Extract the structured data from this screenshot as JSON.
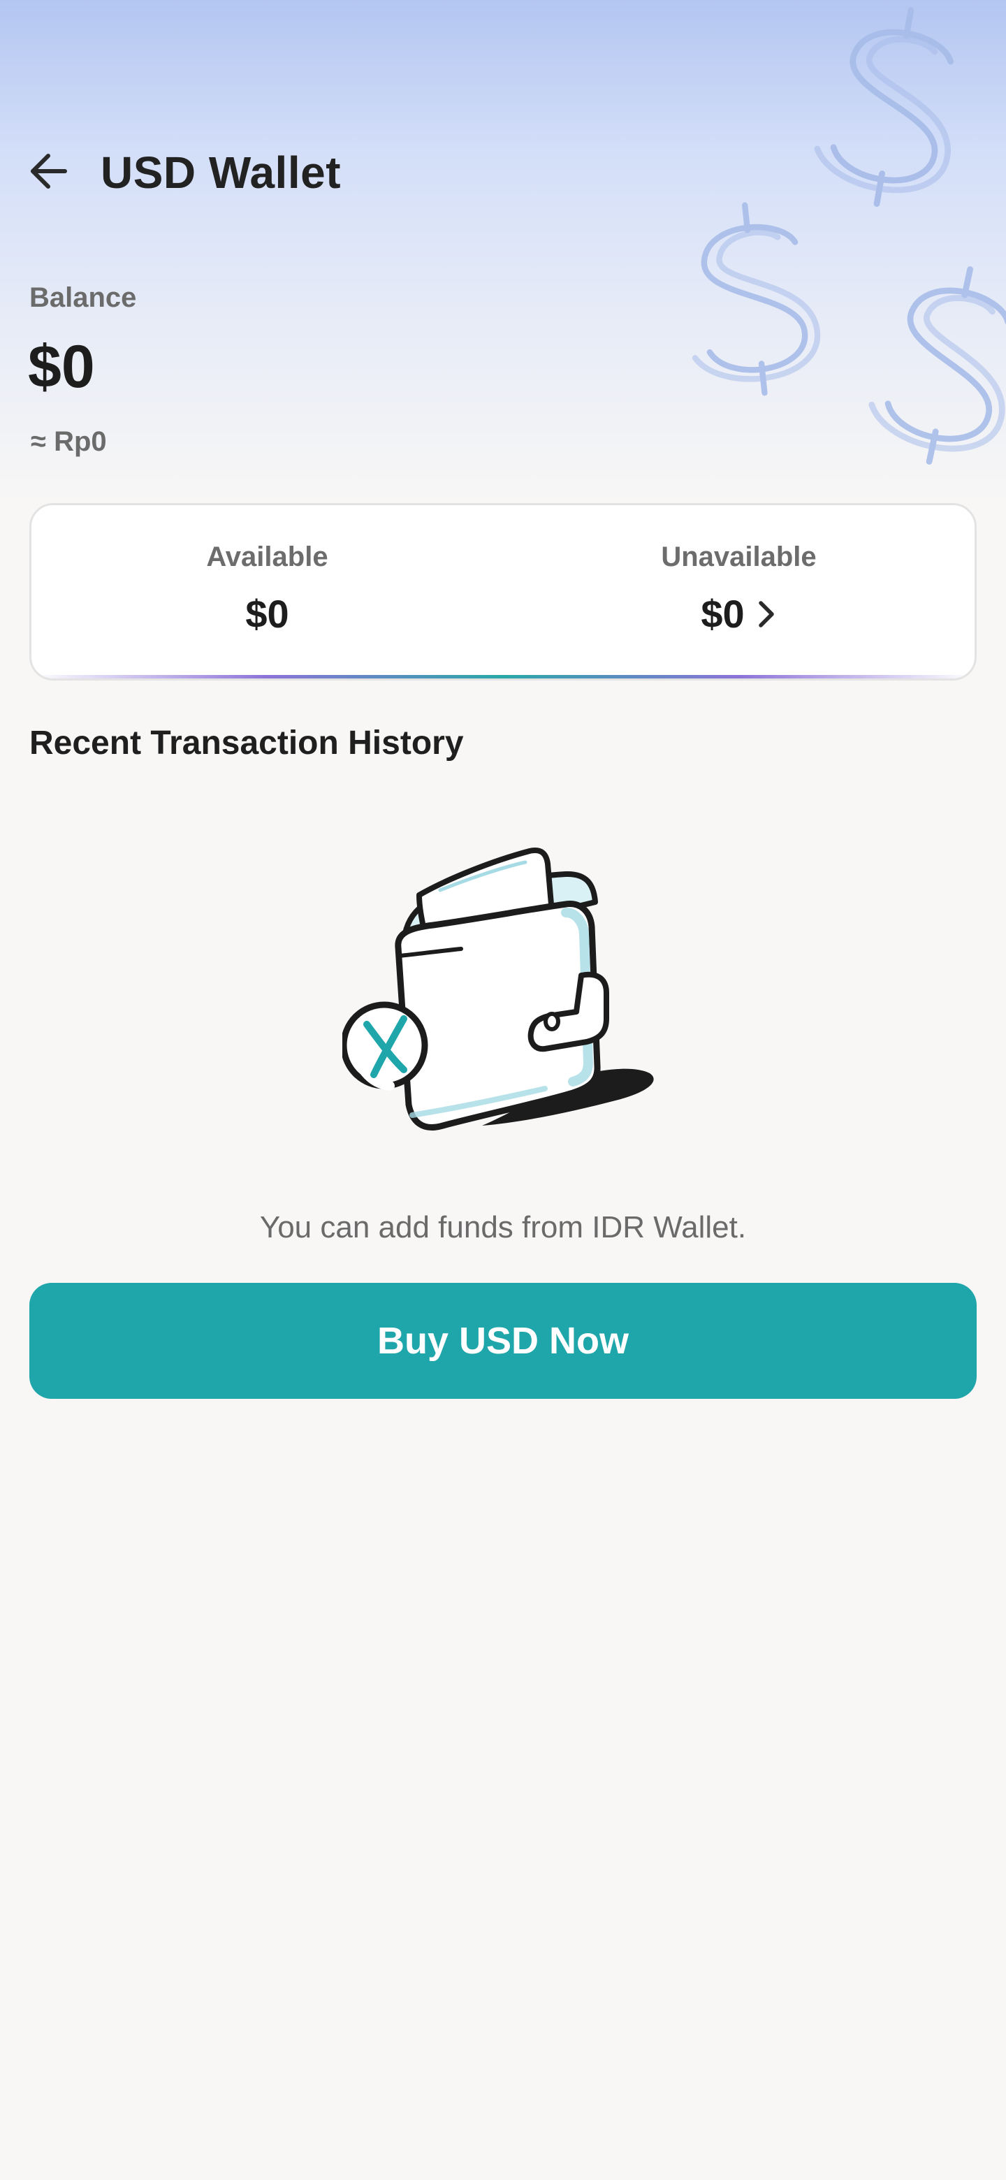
{
  "header": {
    "title": "USD Wallet",
    "back_icon": "arrow-left-icon"
  },
  "balance": {
    "label": "Balance",
    "value": "$0",
    "converted": "≈ Rp0"
  },
  "summary_card": {
    "available": {
      "label": "Available",
      "value": "$0"
    },
    "unavailable": {
      "label": "Unavailable",
      "value": "$0",
      "icon": "chevron-right-icon"
    }
  },
  "history": {
    "title": "Recent Transaction History",
    "empty_illustration": "empty-wallet-icon",
    "empty_message": "You can add funds from IDR Wallet."
  },
  "cta": {
    "label": "Buy USD Now"
  },
  "colors": {
    "accent": "#1ea6aa",
    "background": "#f8f7f6",
    "hero_gradient_top": "#b3c6f1"
  }
}
